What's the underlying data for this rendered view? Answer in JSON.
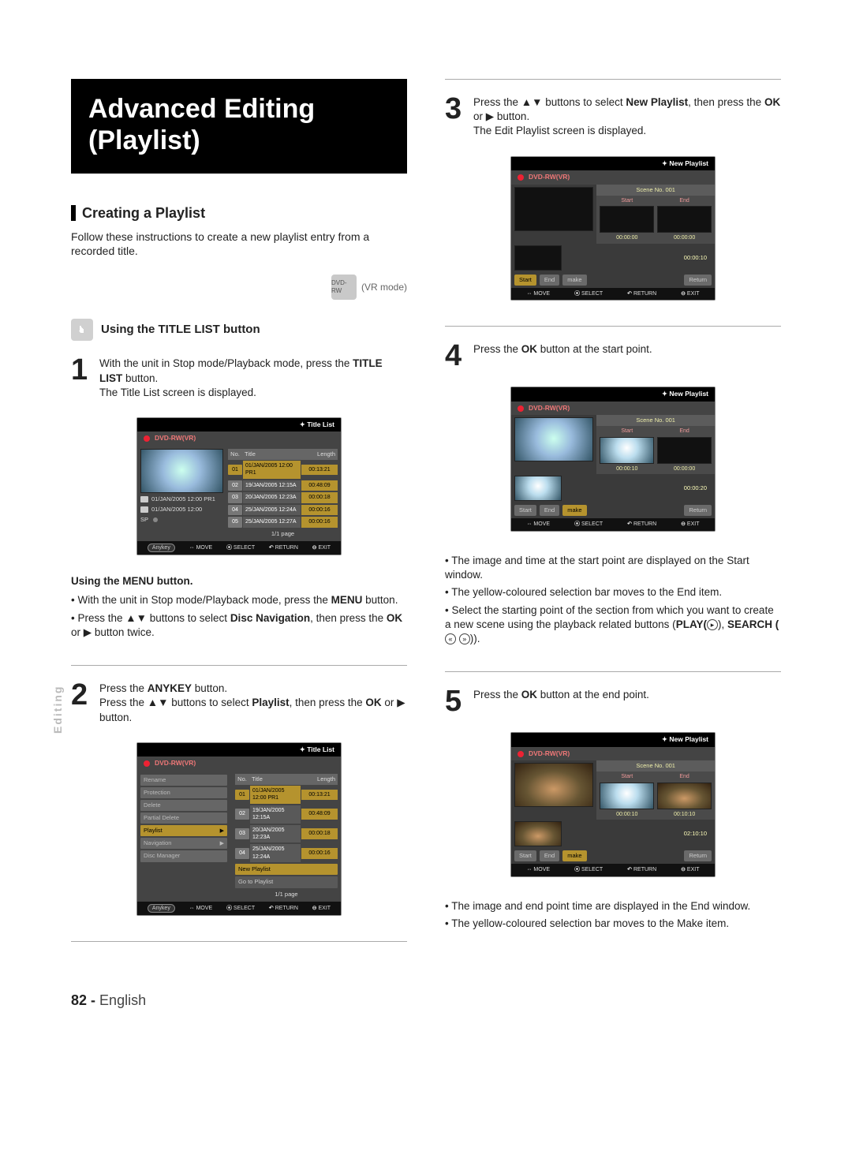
{
  "side_tab": "Editing",
  "heading": "Advanced Editing (Playlist)",
  "section1": {
    "title": "Creating a Playlist",
    "intro": "Follow these instructions to create a new playlist entry from a recorded title.",
    "vr_mode": "(VR mode)",
    "disc_label": "DVD-RW"
  },
  "sub1": {
    "title": "Using the TITLE LIST button"
  },
  "steps": {
    "s1_pre": "With the unit in Stop mode/Playback mode, press the ",
    "s1_bold": "TITLE LIST",
    "s1_post": " button.",
    "s1_line2": "The Title List screen is displayed.",
    "menu_title": "Using the MENU button.",
    "menu_li1_pre": "With the unit in Stop mode/Playback mode, press the ",
    "menu_li1_bold": "MENU",
    "menu_li1_post": " button.",
    "menu_li2_pre": "Press the ",
    "menu_li2_mid": " buttons to select ",
    "menu_li2_b1": "Disc Navigation",
    "menu_li2_mid2": ", then press the ",
    "menu_li2_b2": "OK",
    "menu_li2_mid3": " or ",
    "menu_li2_post": " button twice.",
    "s2_l1_pre": "Press the ",
    "s2_l1_b": "ANYKEY",
    "s2_l1_post": " button.",
    "s2_l2_pre": "Press the ",
    "s2_l2_mid": " buttons to select ",
    "s2_l2_b": "Playlist",
    "s2_l2_mid2": ", then press the ",
    "s2_l2_b2": "OK",
    "s2_l2_mid3": " or ",
    "s2_l2_post": " button.",
    "s3_pre": "Press the ",
    "s3_mid": " buttons to select ",
    "s3_b": "New Playlist",
    "s3_mid2": ", then press the ",
    "s3_b2": "OK",
    "s3_mid3": " or ",
    "s3_post": " button.",
    "s3_line2": "The Edit Playlist screen is displayed.",
    "s4_pre": "Press the ",
    "s4_b": "OK",
    "s4_post": " button at the start point.",
    "s4_li1": "The image and time at the start point are displayed on the Start window.",
    "s4_li2": "The yellow-coloured selection bar moves to the End item.",
    "s4_li3_pre": "Select the starting point of the section from which you want to create a new scene using the playback related buttons (",
    "s4_li3_b1": "PLAY(",
    "s4_li3_mid": "), ",
    "s4_li3_b2": "SEARCH (",
    "s4_li3_post": ")).",
    "s5_pre": "Press the ",
    "s5_b": "OK",
    "s5_post": " button at the end point.",
    "s5_li1": "The image and end point time are displayed in the End window.",
    "s5_li2": "The yellow-coloured selection bar moves to the Make item."
  },
  "osd": {
    "title_list": "Title List",
    "disc": "DVD-RW(VR)",
    "cols": {
      "no": "No.",
      "title": "Title",
      "length": "Length"
    },
    "rows": [
      {
        "n": "01",
        "t": "01/JAN/2005 12:00 PR1",
        "l": "00:13:21"
      },
      {
        "n": "02",
        "t": "19/JAN/2005 12:15A",
        "l": "00:48:09"
      },
      {
        "n": "03",
        "t": "20/JAN/2005 12:23A",
        "l": "00:00:18"
      },
      {
        "n": "04",
        "t": "25/JAN/2005 12:24A",
        "l": "00:00:16"
      },
      {
        "n": "05",
        "t": "25/JAN/2005 12:27A",
        "l": "00:00:16"
      }
    ],
    "meta1": "01/JAN/2005 12:00 PR1",
    "meta2": "01/JAN/2005 12:00",
    "sp": "SP",
    "page": "1/1 page",
    "ctx": [
      "Rename",
      "Protection",
      "Delete",
      "Partial Delete",
      "Playlist",
      "Navigation",
      "Disc Manager"
    ],
    "ctx_opts": [
      "New Playlist",
      "Go to Playlist"
    ],
    "np": "New Playlist",
    "scene": "Scene No. 001",
    "start": "Start",
    "end": "End",
    "make": "make",
    "return": "Return",
    "ts_zero": "00:00:00",
    "ts_10s": "00:00:10",
    "ts_20s": "00:00:20",
    "ts_1010": "00:10:10",
    "ts_21010": "02:10:10",
    "bottom": {
      "anykey": "Anykey",
      "move": "MOVE",
      "select": "SELECT",
      "return": "RETURN",
      "exit": "EXIT"
    }
  },
  "footer": {
    "page": "82 -",
    "lang": "English"
  }
}
